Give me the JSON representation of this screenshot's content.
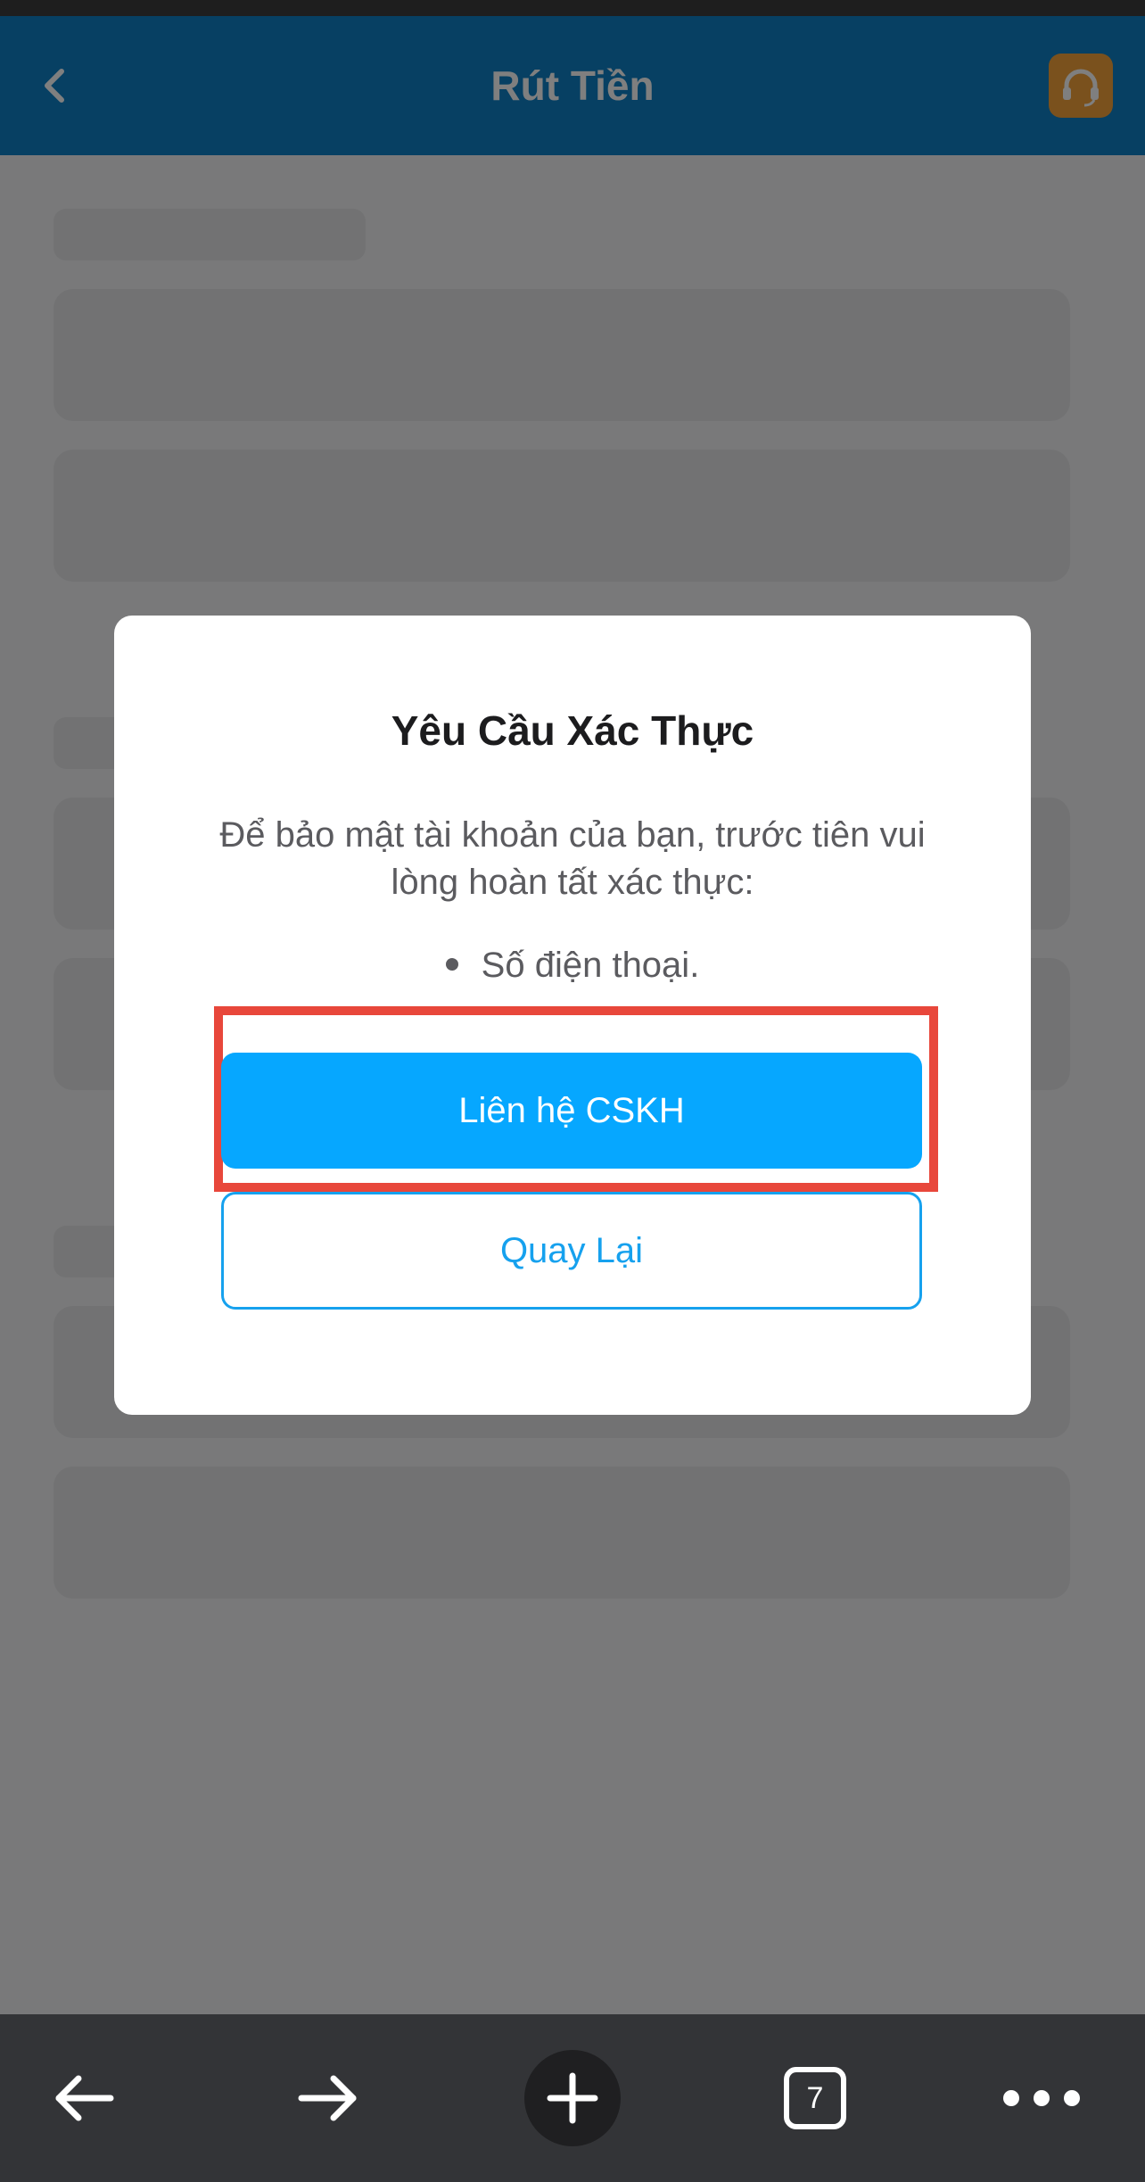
{
  "header": {
    "title": "Rút Tiền",
    "back_icon": "chevron-left-icon",
    "support_icon": "headset-icon",
    "accent_color": "#0e81c7",
    "support_color": "#f5a33a"
  },
  "modal": {
    "title": "Yêu Cầu Xác Thực",
    "description": "Để bảo mật tài khoản của bạn, trước tiên vui lòng hoàn tất xác thực:",
    "bullet": "Số điện thoại.",
    "primary_button": "Liên hệ CSKH",
    "secondary_button": "Quay Lại",
    "primary_color": "#06a7ff",
    "highlight_color": "#e8473b"
  },
  "toolbar": {
    "back_icon": "arrow-left-icon",
    "forward_icon": "arrow-right-icon",
    "new_tab_icon": "plus-icon",
    "tab_count": "7",
    "menu_icon": "more-dots-icon"
  }
}
